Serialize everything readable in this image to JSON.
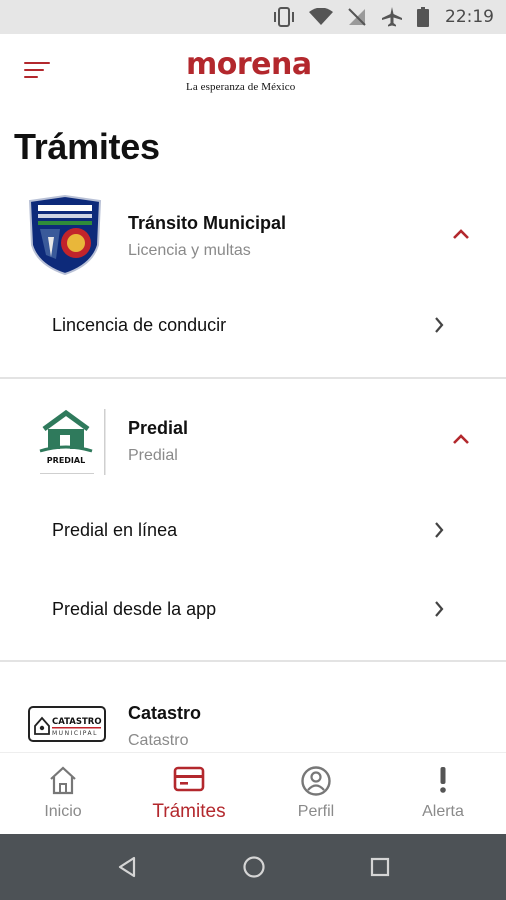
{
  "status_bar": {
    "time": "22:19",
    "icons": [
      "vibrate-icon",
      "wifi-icon",
      "no-signal-icon",
      "airplane-icon",
      "battery-icon"
    ]
  },
  "header": {
    "logo_word": "morena",
    "logo_tagline": "La esperanza de México",
    "menu_icon": "menu-icon"
  },
  "page": {
    "title": "Trámites"
  },
  "categories": [
    {
      "title": "Tránsito Municipal",
      "subtitle": "Licencia y multas",
      "logo": "transito-shield-logo",
      "expanded": true,
      "items": [
        {
          "label": "Lincencia de conducir"
        }
      ]
    },
    {
      "title": "Predial",
      "subtitle": "Predial",
      "logo": "predial-logo",
      "logo_text": "PREDIAL",
      "expanded": true,
      "items": [
        {
          "label": "Predial en línea"
        },
        {
          "label": "Predial desde la app"
        }
      ]
    },
    {
      "title": "Catastro",
      "subtitle": "Catastro",
      "logo": "catastro-logo",
      "logo_text": "CATASTRO",
      "logo_subtext": "MUNICIPAL"
    }
  ],
  "bottom_nav": [
    {
      "label": "Inicio",
      "icon": "home-icon",
      "active": false
    },
    {
      "label": "Trámites",
      "icon": "card-icon",
      "active": true
    },
    {
      "label": "Perfil",
      "icon": "profile-icon",
      "active": false
    },
    {
      "label": "Alerta",
      "icon": "alert-icon",
      "active": false
    }
  ],
  "system_nav": [
    "back-icon",
    "home-circle-icon",
    "recents-icon"
  ],
  "colors": {
    "accent": "#b3282d",
    "muted_text": "#8a8a8a",
    "system_nav_bg": "#4d5256",
    "status_bar_bg": "#e6e6e6"
  }
}
